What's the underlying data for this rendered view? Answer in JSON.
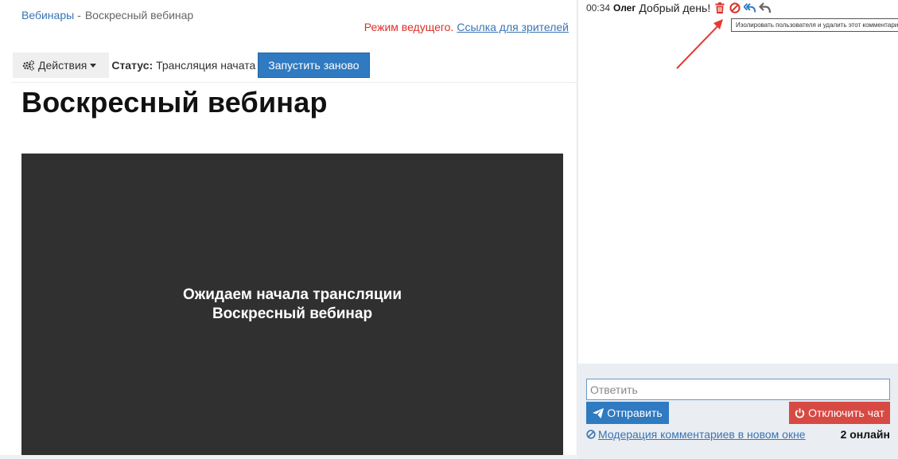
{
  "breadcrumb": {
    "parent": "Вебинары",
    "separator": "-",
    "current": "Воскресный вебинар"
  },
  "mode": {
    "host": "Режим ведущего.",
    "viewers_link": "Ссылка для зрителей"
  },
  "toolbar": {
    "actions_label": "Действия",
    "status_label": "Статус:",
    "status_value": "Трансляция начата",
    "restart_label": "Запустить заново"
  },
  "page_title": "Воскресный вебинар",
  "player": {
    "line1": "Ожидаем начала трансляции",
    "line2": "Воскресный вебинар"
  },
  "chat": {
    "messages": [
      {
        "time": "00:34",
        "author": "Олег",
        "text": "Добрый день!"
      }
    ],
    "tooltip": "Изолировать пользователя и удалить этот комментарий",
    "reply_placeholder": "Ответить",
    "send_label": "Отправить",
    "disable_label": "Отключить чат",
    "moderation_link": "Модерация комментариев в новом окне",
    "online": "2 онлайн"
  },
  "colors": {
    "primary": "#2f7ac1",
    "danger": "#d74a44",
    "link": "#3a74b3",
    "host_mode": "#d9312a",
    "player_bg": "#303030"
  },
  "icons": {
    "actions": "gears-icon",
    "dropdown": "caret-down-icon",
    "delete": "trash-icon",
    "ban": "ban-icon",
    "reply_all": "reply-all-icon",
    "reply": "reply-icon",
    "send": "paper-plane-icon",
    "power": "power-icon",
    "moderation": "ban-icon"
  }
}
